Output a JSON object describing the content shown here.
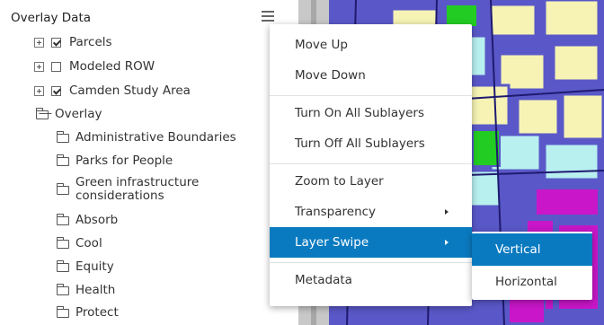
{
  "panel": {
    "title": "Overlay Data",
    "layers": [
      {
        "label": "Parcels",
        "checked": true
      },
      {
        "label": "Modeled ROW",
        "checked": false
      },
      {
        "label": "Camden Study Area",
        "checked": true
      }
    ],
    "group": {
      "label": "Overlay",
      "children": [
        "Administrative Boundaries",
        "Parks for People",
        "Green infrastructure considerations",
        "Absorb",
        "Cool",
        "Equity",
        "Health",
        "Protect"
      ]
    }
  },
  "context_menu": {
    "items": [
      "Move Up",
      "Move Down",
      "Turn On All Sublayers",
      "Turn Off All Sublayers",
      "Zoom to Layer",
      "Transparency",
      "Layer Swipe",
      "Metadata"
    ],
    "active_item": "Layer Swipe"
  },
  "swipe_submenu": {
    "items": [
      "Vertical",
      "Horizontal"
    ],
    "active_item": "Vertical"
  },
  "colors": {
    "accent": "#0a7ac0",
    "map_fill": "#5a58c8",
    "parcel_yellow": "#f6f3b4",
    "parcel_cyan": "#b8f0f0",
    "parcel_green": "#22cc22",
    "parcel_magenta": "#c816c8"
  },
  "icons": {
    "panel_menu": "hamburger-icon",
    "expander": "plus-square-icon",
    "folder_open": "folder-open-icon",
    "folder": "folder-icon",
    "submenu_arrow": "caret-right-icon"
  }
}
